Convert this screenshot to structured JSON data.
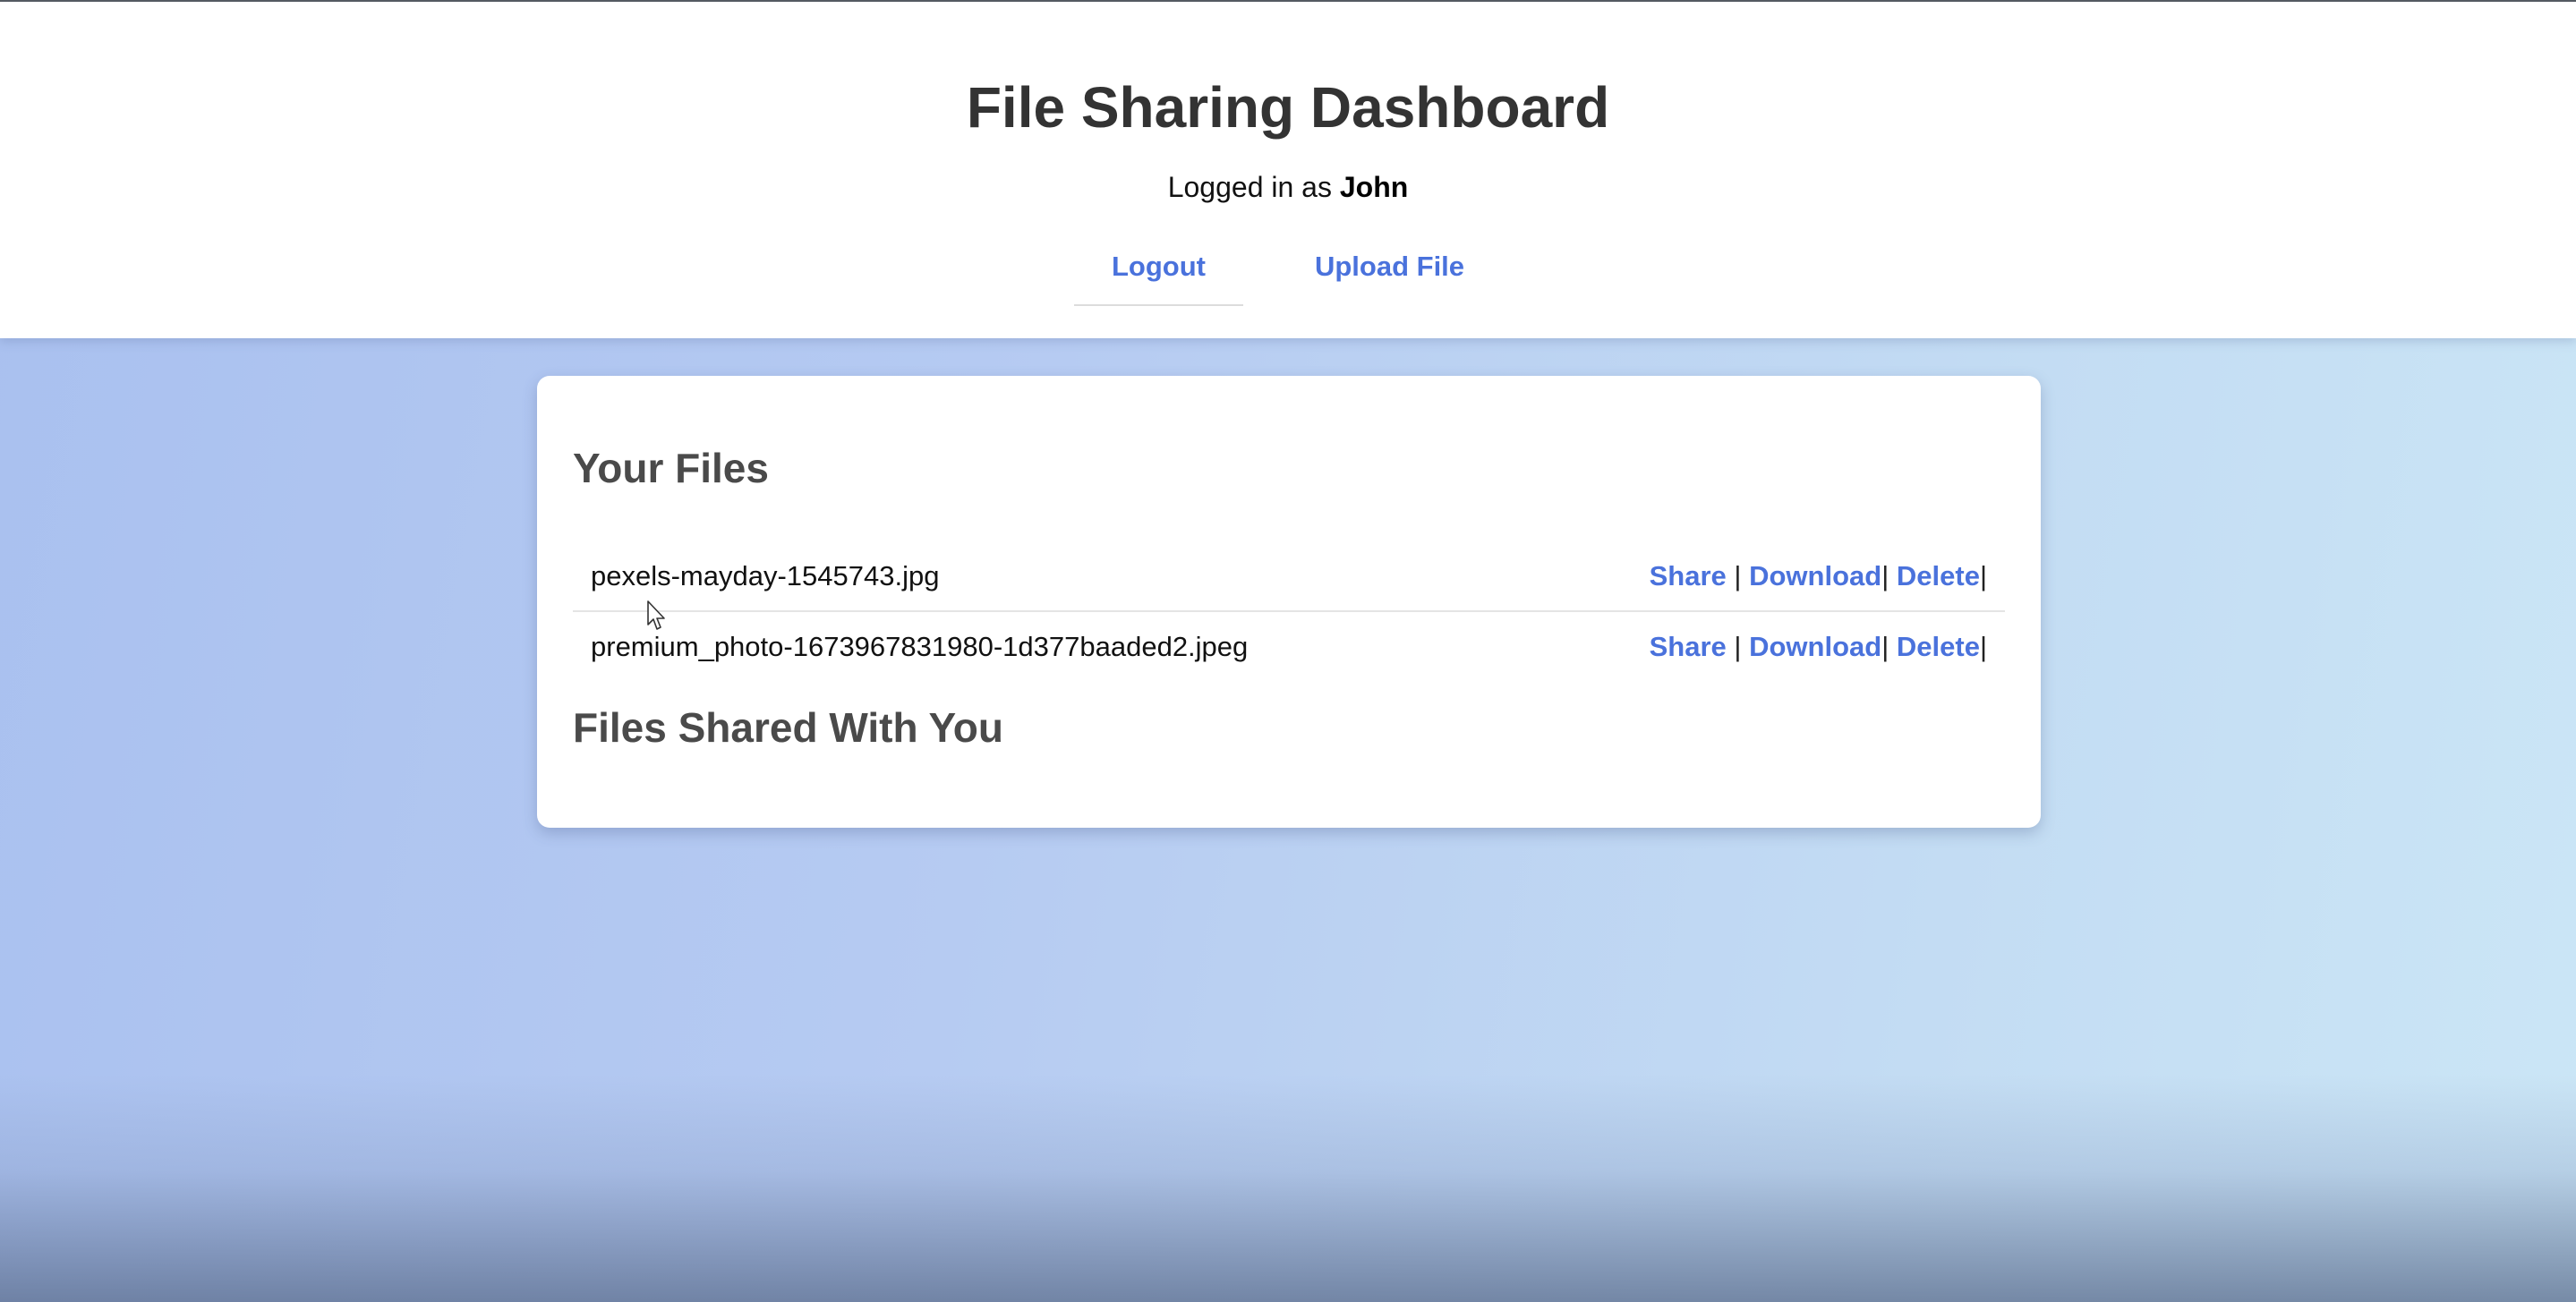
{
  "header": {
    "title": "File Sharing Dashboard",
    "logged_in_prefix": "Logged in as",
    "username": "John"
  },
  "nav": {
    "logout": "Logout",
    "upload": "Upload File"
  },
  "your_files": {
    "title": "Your Files",
    "files": [
      {
        "name": "pexels-mayday-1545743.jpg",
        "share": "Share",
        "download": "Download",
        "delete": "Delete"
      },
      {
        "name": "premium_photo-1673967831980-1d377baaded2.jpeg",
        "share": "Share",
        "download": "Download",
        "delete": "Delete"
      }
    ]
  },
  "shared": {
    "title": "Files Shared With You"
  },
  "separators": {
    "pipe": "|"
  },
  "colors": {
    "link": "#4a72dc",
    "title_text": "#333333",
    "section_text": "#4a4a4a",
    "background_start": "#a9c0ef",
    "background_end": "#cbe6f6"
  },
  "icons": {
    "cursor": "mouse-pointer-icon"
  }
}
